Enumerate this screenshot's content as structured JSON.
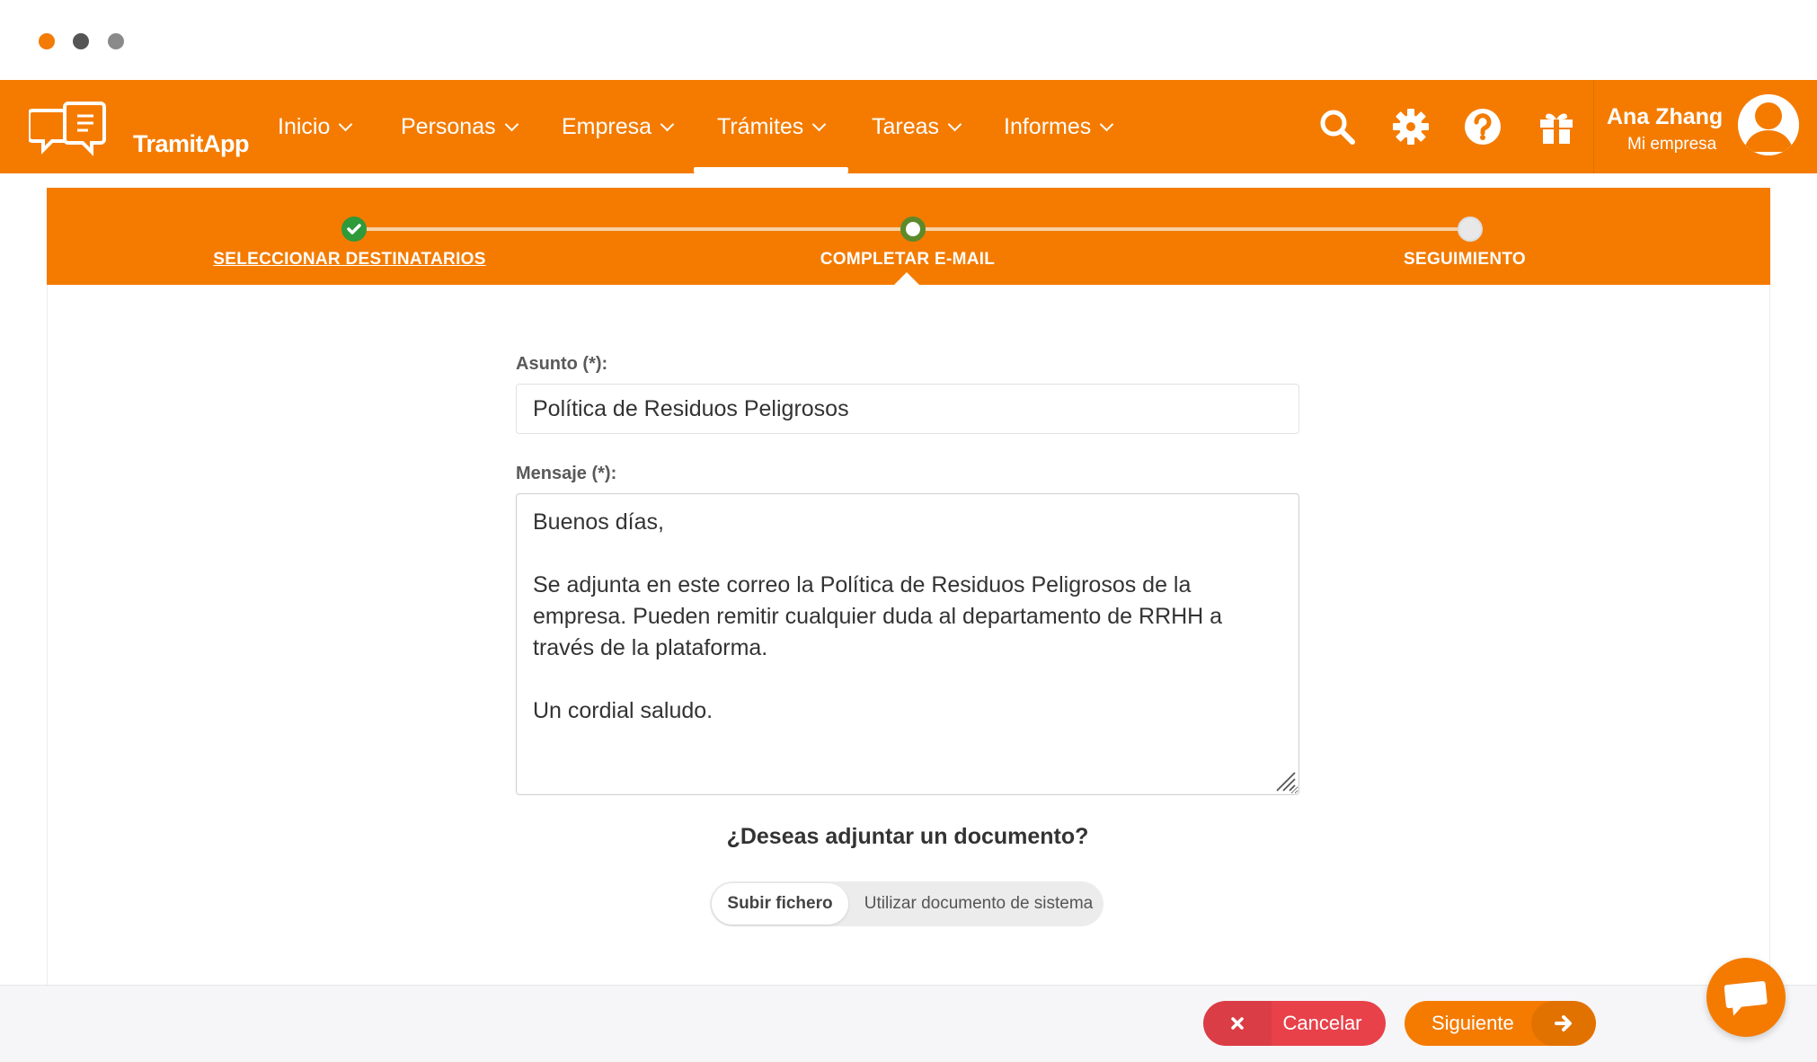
{
  "app": {
    "logo_word1": "Tramit",
    "logo_word2": "App",
    "brand_color": "#f47b00"
  },
  "nav": {
    "items": [
      {
        "label": "Inicio"
      },
      {
        "label": "Personas"
      },
      {
        "label": "Empresa"
      },
      {
        "label": "Trámites",
        "active": true
      },
      {
        "label": "Tareas"
      },
      {
        "label": "Informes"
      }
    ],
    "icons": [
      "search-icon",
      "gear-icon",
      "help-icon",
      "gift-icon"
    ]
  },
  "user": {
    "name": "Ana Zhang",
    "company": "Mi empresa"
  },
  "stepper": {
    "steps": [
      {
        "label": "SELECCIONAR DESTINATARIOS",
        "state": "done"
      },
      {
        "label": "COMPLETAR E-MAIL",
        "state": "current"
      },
      {
        "label": "SEGUIMIENTO",
        "state": "pending"
      }
    ]
  },
  "form": {
    "subject_label": "Asunto (*):",
    "subject_value": "Política de Residuos Peligrosos",
    "message_label": "Mensaje (*):",
    "message_value": "Buenos días,\n\nSe adjunta en este correo la Política de Residuos Peligrosos de la empresa. Pueden remitir cualquier duda al departamento de RRHH a través de la plataforma.\n\nUn cordial saludo.",
    "attach_question": "¿Deseas adjuntar un documento?",
    "attach_options": [
      {
        "label": "Subir fichero",
        "selected": true
      },
      {
        "label": "Utilizar documento de sistema",
        "selected": false
      }
    ]
  },
  "footer": {
    "cancel_label": "Cancelar",
    "next_label": "Siguiente",
    "cancel_color": "#e8414a"
  }
}
